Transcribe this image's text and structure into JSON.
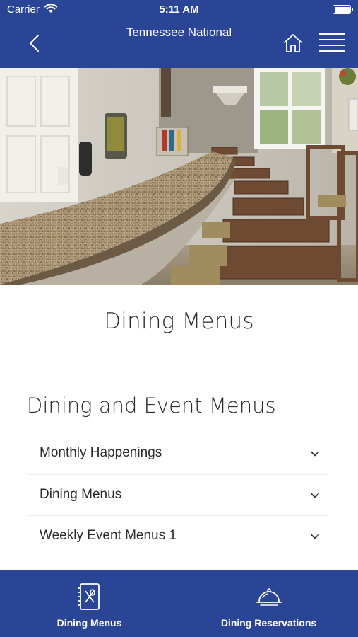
{
  "status": {
    "carrier": "Carrier",
    "time": "5:11 AM"
  },
  "header": {
    "title": "Tennessee National"
  },
  "page": {
    "title": "Dining Menus",
    "section_title": "Dining and Event Menus"
  },
  "accordion": [
    {
      "label": "Monthly Happenings"
    },
    {
      "label": "Dining Menus"
    },
    {
      "label": "Weekly Event Menus 1"
    }
  ],
  "tabs": [
    {
      "label": "Dining Menus",
      "icon": "menu-book-icon"
    },
    {
      "label": "Dining Reservations",
      "icon": "cloche-icon"
    }
  ],
  "colors": {
    "brand": "#2b4596",
    "background": "#ffffff",
    "text": "#2a2a2a"
  }
}
